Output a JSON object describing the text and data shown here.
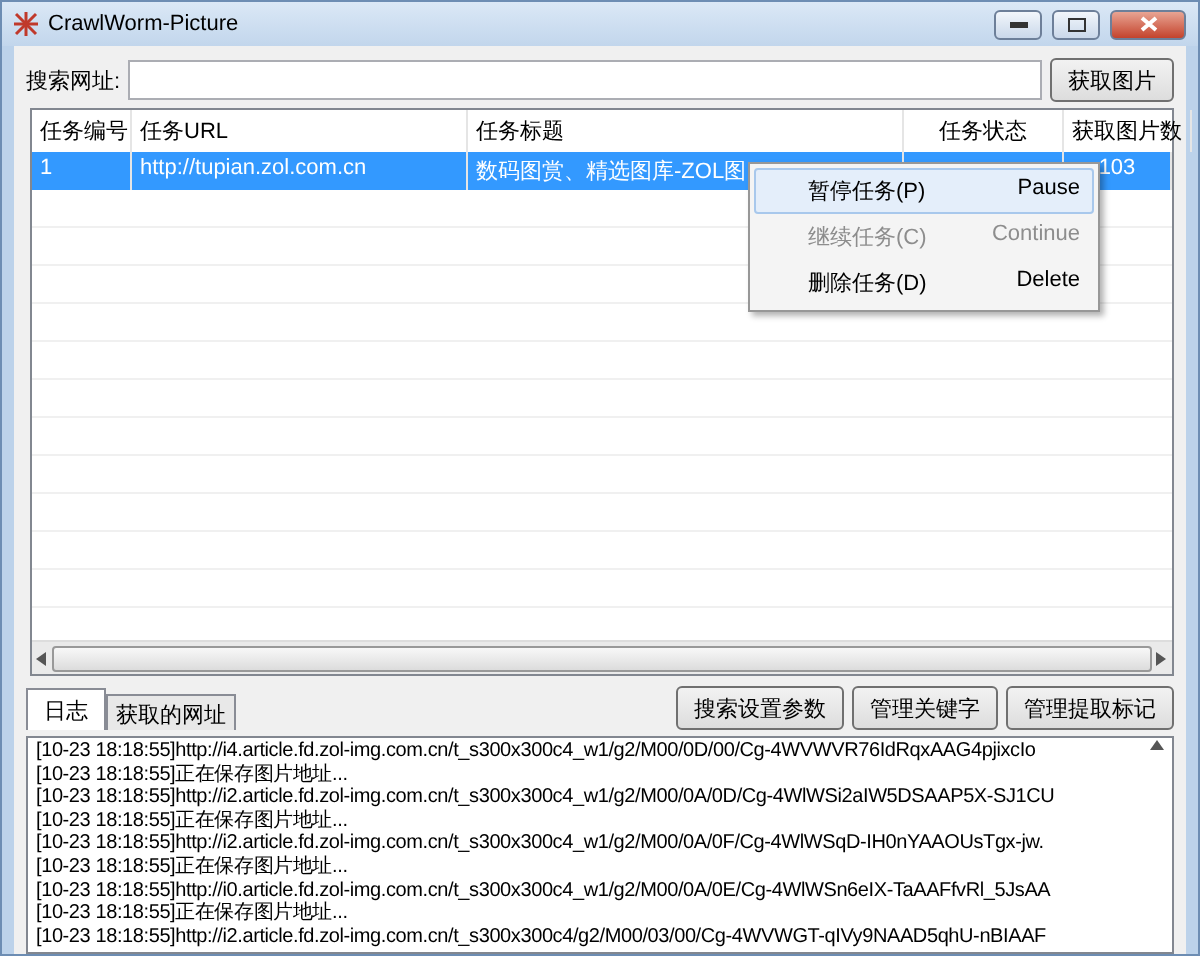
{
  "window": {
    "title": "CrawlWorm-Picture"
  },
  "search": {
    "label": "搜索网址:",
    "button": "获取图片"
  },
  "table": {
    "columns": [
      "任务编号",
      "任务URL",
      "任务标题",
      "任务状态",
      "获取图片数"
    ],
    "rows": [
      {
        "selected": true,
        "cells": [
          "1",
          "http://tupian.zol.com.cn",
          "数码图赏、精选图库-ZOL图",
          "",
          "103"
        ]
      }
    ]
  },
  "context_menu": [
    {
      "label": "暂停任务(P)",
      "shortcut": "Pause",
      "disabled": false,
      "selected": true
    },
    {
      "label": "继续任务(C)",
      "shortcut": "Continue",
      "disabled": true,
      "selected": false
    },
    {
      "label": "删除任务(D)",
      "shortcut": "Delete",
      "disabled": false,
      "selected": false
    }
  ],
  "tabs": [
    {
      "label": "日志",
      "selected": true
    },
    {
      "label": "获取的网址",
      "selected": false
    }
  ],
  "buttons": [
    "搜索设置参数",
    "管理关键字",
    "管理提取标记"
  ],
  "log": [
    "[10-23 18:18:55]http://i4.article.fd.zol-img.com.cn/t_s300x300c4_w1/g2/M00/0D/00/Cg-4WVWVR76IdRqxAAG4pjixcIo",
    "[10-23 18:18:55]正在保存图片地址...",
    "[10-23 18:18:55]http://i2.article.fd.zol-img.com.cn/t_s300x300c4_w1/g2/M00/0A/0D/Cg-4WlWSi2aIW5DSAAP5X-SJ1CU",
    "[10-23 18:18:55]正在保存图片地址...",
    "[10-23 18:18:55]http://i2.article.fd.zol-img.com.cn/t_s300x300c4_w1/g2/M00/0A/0F/Cg-4WlWSqD-IH0nYAAOUsTgx-jw.",
    "[10-23 18:18:55]正在保存图片地址...",
    "[10-23 18:18:55]http://i0.article.fd.zol-img.com.cn/t_s300x300c4_w1/g2/M00/0A/0E/Cg-4WlWSn6eIX-TaAAFfvRl_5JsAA",
    "[10-23 18:18:55]正在保存图片地址...",
    "[10-23 18:18:55]http://i2.article.fd.zol-img.com.cn/t_s300x300c4/g2/M00/03/00/Cg-4WVWGT-qIVy9NAAD5qhU-nBIAAF"
  ]
}
